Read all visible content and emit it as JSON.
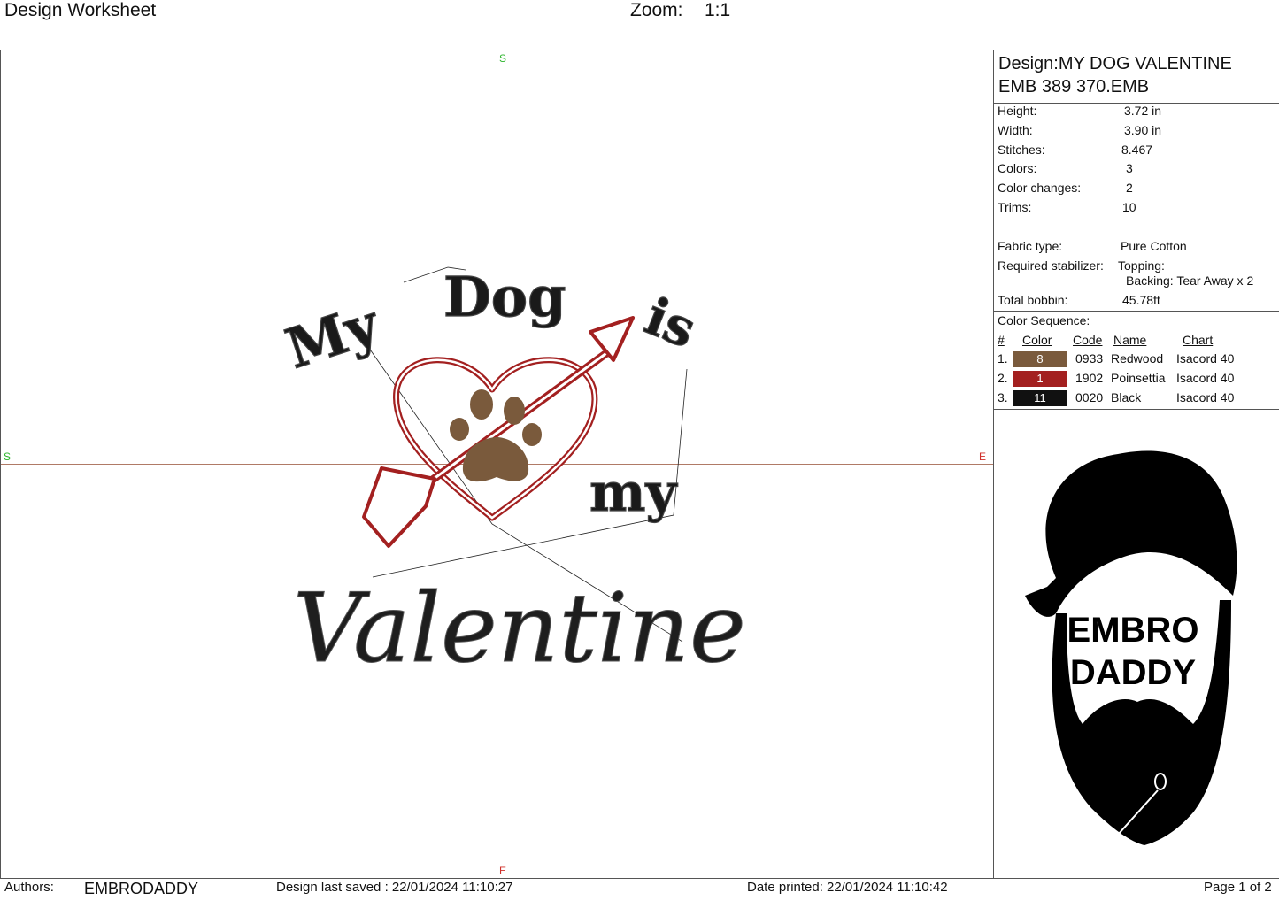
{
  "header": {
    "title": "Design Worksheet",
    "zoom_label": "Zoom:",
    "zoom_value": "1:1"
  },
  "canvas": {
    "axis_labels": {
      "top": "S",
      "left": "S",
      "right": "E",
      "bottom": "E"
    },
    "design_text": {
      "line1a": "My",
      "line1b": "Dog",
      "line1c": "is",
      "line2": "my",
      "line3": "Valentine"
    },
    "thread_colors": {
      "redwood": "#7a5a3c",
      "poinsettia": "#a32020",
      "black": "#111111"
    }
  },
  "panel": {
    "design_title": "Design:MY DOG VALENTINE",
    "file_name": "EMB 389 370.EMB",
    "stats": [
      {
        "label": "Height:",
        "value": "3.72 in"
      },
      {
        "label": "Width:",
        "value": "3.90 in"
      },
      {
        "label": "Stitches:",
        "value": "8.467"
      },
      {
        "label": "Colors:",
        "value": "3"
      },
      {
        "label": "Color changes:",
        "value": "2"
      },
      {
        "label": "Trims:",
        "value": "10"
      }
    ],
    "fabric_label": "Fabric type:",
    "fabric_value": "Pure Cotton",
    "stabilizer_label": "Required stabilizer:",
    "topping": "Topping:",
    "backing": "Backing: Tear Away x 2",
    "bobbin_label": "Total bobbin:",
    "bobbin_value": "45.78ft",
    "color_seq_title": "Color Sequence:",
    "col_headers": {
      "num": "#",
      "color": "Color",
      "code": "Code",
      "name": "Name",
      "chart": "Chart"
    },
    "colors": [
      {
        "num": "1.",
        "swatch": "8",
        "hex": "#7a5a3c",
        "code": "0933",
        "name": "Redwood",
        "chart": "Isacord 40"
      },
      {
        "num": "2.",
        "swatch": "1",
        "hex": "#a32020",
        "code": "1902",
        "name": "Poinsettia",
        "chart": "Isacord 40"
      },
      {
        "num": "3.",
        "swatch": "11",
        "hex": "#111111",
        "code": "0020",
        "name": "Black",
        "chart": "Isacord 40"
      }
    ],
    "logo": {
      "line1": "EMBRO",
      "line2": "DADDY"
    }
  },
  "footer": {
    "authors_label": "Authors:",
    "authors_value": "EMBRODADDY",
    "saved": "Design last saved : 22/01/2024 11:10:27",
    "printed": "Date printed: 22/01/2024 11:10:42",
    "page": "Page 1 of 2"
  }
}
